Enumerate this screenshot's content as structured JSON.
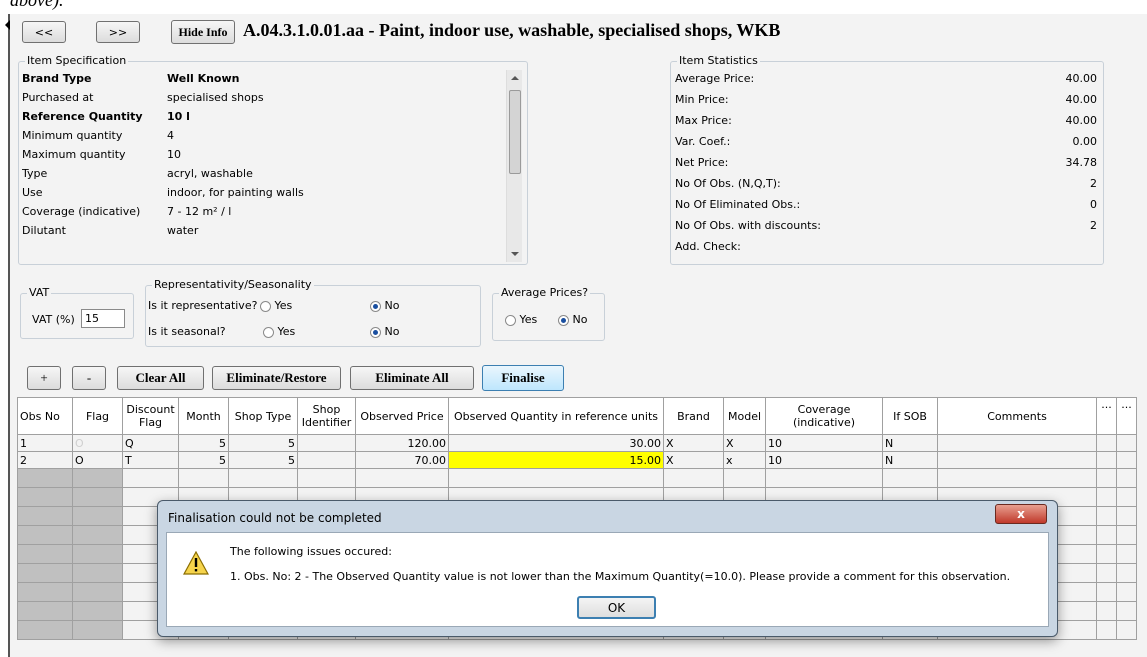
{
  "nav": {
    "prev_label": "<<",
    "next_label": ">>",
    "hide_info_label": "Hide Info"
  },
  "page_title": "A.04.3.1.0.01.aa - Paint, indoor use, washable, specialised shops, WKB",
  "top_clip": "above).",
  "spec": {
    "legend": "Item Specification",
    "rows": [
      {
        "label": "Brand Type",
        "value": "Well Known",
        "bold": true
      },
      {
        "label": "Purchased at",
        "value": "specialised shops"
      },
      {
        "label": "Reference Quantity",
        "value": "10 l",
        "bold": true
      },
      {
        "label": "Minimum quantity",
        "value": "4"
      },
      {
        "label": "Maximum quantity",
        "value": "10"
      },
      {
        "label": "Type",
        "value": "acryl, washable"
      },
      {
        "label": "Use",
        "value": "indoor, for painting walls"
      },
      {
        "label": "Coverage (indicative)",
        "value": "7 - 12 m² / l"
      },
      {
        "label": "Dilutant",
        "value": "water"
      }
    ]
  },
  "stats": {
    "legend": "Item Statistics",
    "rows": [
      {
        "label": "Average Price:",
        "value": "40.00"
      },
      {
        "label": "Min Price:",
        "value": "40.00"
      },
      {
        "label": "Max Price:",
        "value": "40.00"
      },
      {
        "label": "Var. Coef.:",
        "value": "0.00"
      },
      {
        "label": "Net Price:",
        "value": "34.78"
      },
      {
        "label": "No Of Obs. (N,Q,T):",
        "value": "2"
      },
      {
        "label": "No Of Eliminated Obs.:",
        "value": "0"
      },
      {
        "label": "No Of Obs. with discounts:",
        "value": "2"
      },
      {
        "label": "Add. Check:",
        "value": ""
      }
    ]
  },
  "vat": {
    "legend": "VAT",
    "label": "VAT (%)",
    "value": "15"
  },
  "rep": {
    "legend": "Representativity/Seasonality",
    "q1": "Is it representative?",
    "q2": "Is it seasonal?",
    "yes": "Yes",
    "no": "No"
  },
  "avg": {
    "legend": "Average Prices?",
    "yes": "Yes",
    "no": "No"
  },
  "toolbar": {
    "plus": "+",
    "minus": "-",
    "clear_all": "Clear All",
    "eliminate_restore": "Eliminate/Restore",
    "eliminate_all": "Eliminate All",
    "finalise": "Finalise"
  },
  "table": {
    "headers": [
      "Obs No",
      "Flag",
      "Discount Flag",
      "Month",
      "Shop Type",
      "Shop Identifier",
      "Observed Price",
      "Observed Quantity in reference units",
      "Brand",
      "Model",
      "Coverage (indicative)",
      "If SOB",
      "Comments",
      "..."
    ],
    "rows": [
      [
        "1",
        "O",
        "Q",
        "5",
        "5",
        "",
        "120.00",
        "30.00",
        "X",
        "X",
        "10",
        "N",
        ""
      ],
      [
        "2",
        "O",
        "T",
        "5",
        "5",
        "",
        "70.00",
        "15.00",
        "X",
        "x",
        "10",
        "N",
        ""
      ]
    ],
    "highlight_color": "#ffff00"
  },
  "dialog": {
    "title": "Finalisation could not be completed",
    "heading": "The following issues occured:",
    "message": "1. Obs. No: 2 - The Observed Quantity value is not lower than the Maximum Quantity(=10.0). Please provide a comment for this observation.",
    "ok_label": "OK",
    "close_label": "x"
  }
}
